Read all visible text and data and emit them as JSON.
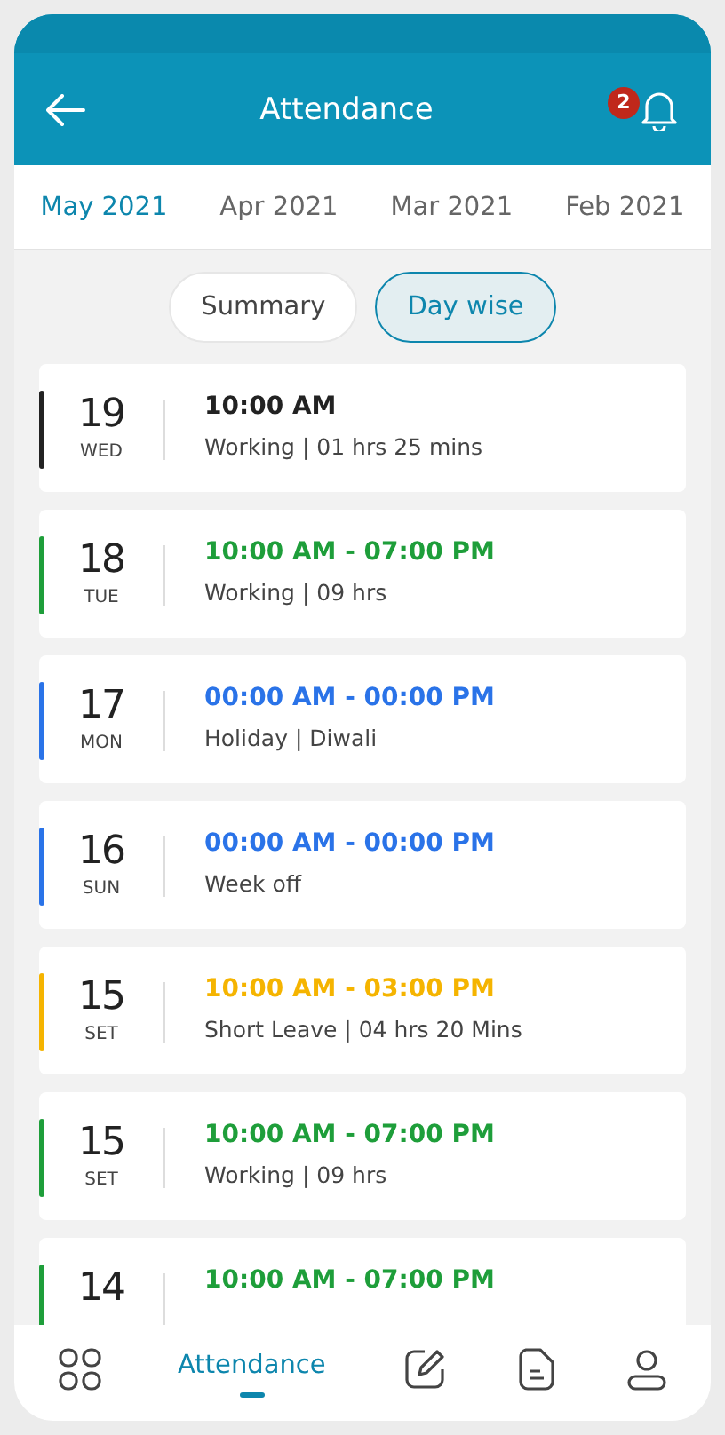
{
  "header": {
    "title": "Attendance",
    "notification_count": "2"
  },
  "tabs": [
    {
      "label": "May 2021",
      "selected": true
    },
    {
      "label": "Apr 2021",
      "selected": false
    },
    {
      "label": "Mar 2021",
      "selected": false
    },
    {
      "label": "Feb 2021",
      "selected": false
    }
  ],
  "view_toggle": [
    {
      "label": "Summary",
      "selected": false
    },
    {
      "label": "Day wise",
      "selected": true
    }
  ],
  "entries": [
    {
      "day": "19",
      "weekday": "WED",
      "time": "10:00 AM",
      "detail": "Working | 01 hrs 25 mins",
      "color": "#222222"
    },
    {
      "day": "18",
      "weekday": "TUE",
      "time": "10:00 AM - 07:00 PM",
      "detail": "Working | 09 hrs",
      "color": "#1e9e3a"
    },
    {
      "day": "17",
      "weekday": "MON",
      "time": "00:00 AM - 00:00 PM",
      "detail": "Holiday | Diwali",
      "color": "#2a73e8"
    },
    {
      "day": "16",
      "weekday": "SUN",
      "time": "00:00 AM - 00:00 PM",
      "detail": "Week off",
      "color": "#2a73e8"
    },
    {
      "day": "15",
      "weekday": "SET",
      "time": "10:00 AM - 03:00 PM",
      "detail": "Short Leave | 04 hrs 20 Mins",
      "color": "#f5b400"
    },
    {
      "day": "15",
      "weekday": "SET",
      "time": "10:00 AM - 07:00 PM",
      "detail": "Working | 09 hrs",
      "color": "#1e9e3a"
    },
    {
      "day": "14",
      "time": "10:00 AM - 07:00 PM",
      "color": "#1e9e3a"
    }
  ],
  "bottom_nav": [
    {
      "selected": false
    },
    {
      "label": "Attendance",
      "selected": true
    },
    {
      "selected": false
    },
    {
      "selected": false
    },
    {
      "selected": false
    }
  ]
}
